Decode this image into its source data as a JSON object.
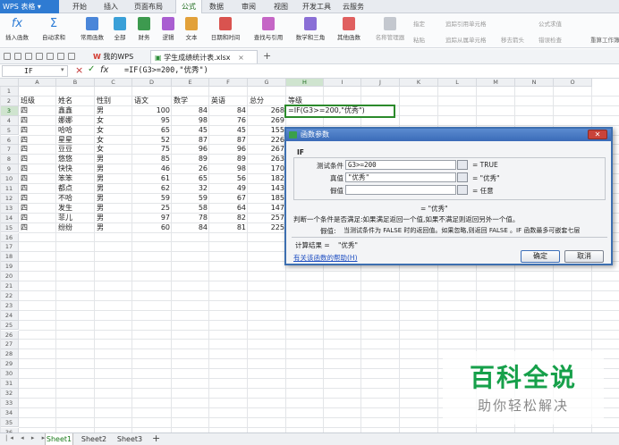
{
  "app": {
    "name": "WPS 表格"
  },
  "menu_tabs": [
    "开始",
    "插入",
    "页面布局",
    "公式",
    "数据",
    "审阅",
    "视图",
    "开发工具",
    "云服务"
  ],
  "active_menu_tab": "公式",
  "ribbon": {
    "buttons": [
      "插入函数",
      "自动求和",
      "常用函数",
      "全部",
      "财务",
      "逻辑",
      "文本",
      "日期和时间",
      "查找与引用",
      "数学和三角",
      "其他函数",
      "名称管理器"
    ],
    "group1": [
      "指定",
      "粘贴"
    ],
    "group2": [
      "追踪引用单元格",
      "追踪从属单元格",
      "移去箭头",
      "公式求值",
      "错误检查"
    ],
    "recalc": "重算工作簿"
  },
  "tabs": {
    "docs": [
      "我的WPS",
      "学生成绩统计表.xlsx"
    ]
  },
  "formula_bar": {
    "name_box": "IF",
    "formula": "=IF(G3>=200,\"优秀\")"
  },
  "columns": [
    "A",
    "B",
    "C",
    "D",
    "E",
    "F",
    "G",
    "H",
    "I",
    "J",
    "K",
    "L",
    "M",
    "N",
    "O"
  ],
  "row_numbers": [
    "1",
    "2",
    "3",
    "4",
    "5",
    "6",
    "7",
    "8",
    "9",
    "10",
    "11",
    "12",
    "13",
    "14",
    "15",
    "16",
    "17",
    "18",
    "19",
    "20",
    "21",
    "22",
    "23",
    "24",
    "25",
    "26",
    "27",
    "28",
    "29",
    "30",
    "31",
    "32",
    "33",
    "34",
    "35",
    "36",
    "37"
  ],
  "headers": [
    "班级",
    "姓名",
    "性别",
    "语文",
    "数学",
    "英语",
    "总分",
    "等级"
  ],
  "rows": [
    [
      "四",
      "鑫鑫",
      "男",
      "100",
      "84",
      "84",
      "268"
    ],
    [
      "四",
      "娜娜",
      "女",
      "95",
      "98",
      "76",
      "269"
    ],
    [
      "四",
      "哈哈",
      "女",
      "65",
      "45",
      "45",
      "155"
    ],
    [
      "四",
      "星星",
      "女",
      "52",
      "87",
      "87",
      "226"
    ],
    [
      "四",
      "豆豆",
      "女",
      "75",
      "96",
      "96",
      "267"
    ],
    [
      "四",
      "悠悠",
      "男",
      "85",
      "89",
      "89",
      "263"
    ],
    [
      "四",
      "快快",
      "男",
      "46",
      "26",
      "98",
      "170"
    ],
    [
      "四",
      "笨笨",
      "男",
      "61",
      "65",
      "56",
      "182"
    ],
    [
      "四",
      "都点",
      "男",
      "62",
      "32",
      "49",
      "143"
    ],
    [
      "四",
      "不哈",
      "男",
      "59",
      "59",
      "67",
      "185"
    ],
    [
      "四",
      "发生",
      "男",
      "25",
      "58",
      "64",
      "147"
    ],
    [
      "四",
      "菲儿",
      "男",
      "97",
      "78",
      "82",
      "257"
    ],
    [
      "四",
      "纷纷",
      "男",
      "60",
      "84",
      "81",
      "225"
    ]
  ],
  "edit_cell": "=IF(G3>=200,\"优秀\")",
  "dialog": {
    "title": "函数参数",
    "fn": "IF",
    "args": [
      {
        "label": "测试条件",
        "value": "G3>=200",
        "result": "= TRUE"
      },
      {
        "label": "真值",
        "value": "\"优秀\"",
        "result": "= \"优秀\""
      },
      {
        "label": "假值",
        "value": "",
        "result": "= 任意"
      }
    ],
    "mid_result": "= \"优秀\"",
    "desc": "判断一个条件是否满足:如果满足返回一个值,如果不满足则返回另外一个值。",
    "arg_desc_label": "假值:",
    "arg_desc": "当测试条件为 FALSE 时的返回值。如果忽略,则返回 FALSE 。IF 函数最多可嵌套七层",
    "calc_label": "计算结果 =",
    "calc_value": "\"优秀\"",
    "help": "有关该函数的帮助(H)",
    "ok": "确定",
    "cancel": "取消"
  },
  "sheets": [
    "Sheet1",
    "Sheet2",
    "Sheet3"
  ],
  "watermark": {
    "title": "百科全说",
    "subtitle": "助你轻松解决"
  }
}
